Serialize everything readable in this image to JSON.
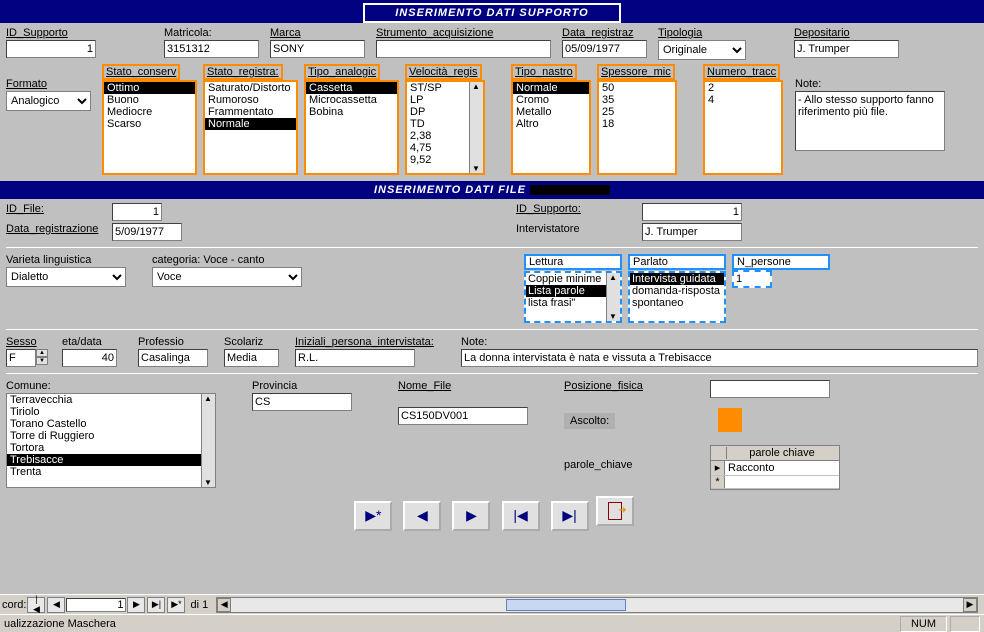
{
  "header1": "INSERIMENTO DATI SUPPORTO",
  "header2": "INSERIMENTO DATI FILE",
  "supporto": {
    "id_label": "ID_Supporto",
    "id_value": "1",
    "matricola_label": "Matricola:",
    "matricola_value": "3151312",
    "marca_label": "Marca",
    "marca_value": "SONY",
    "strumento_label": "Strumento_acquisizione",
    "strumento_value": "",
    "data_label": "Data_registraz",
    "data_value": "05/09/1977",
    "tipologia_label": "Tipologia",
    "tipologia_value": "Originale",
    "depositario_label": "Depositario",
    "depositario_value": "J. Trumper",
    "formato_label": "Formato",
    "formato_value": "Analogico",
    "note_label": "Note:",
    "note_value": "- Allo stesso supporto fanno riferimento più file."
  },
  "boxes": {
    "stato_conserv": {
      "title": "Stato_conserv",
      "items": [
        "Ottimo",
        "Buono",
        "Mediocre",
        "Scarso"
      ],
      "selected": "Ottimo"
    },
    "stato_registra": {
      "title": "Stato_registra:",
      "items": [
        "Saturato/Distorto",
        "Rumoroso",
        "Frammentato",
        "Normale"
      ],
      "selected": "Normale"
    },
    "tipo_analogic": {
      "title": "Tipo_analogic",
      "items": [
        "Cassetta",
        "Microcassetta",
        "Bobina"
      ],
      "selected": "Cassetta"
    },
    "velocita": {
      "title": "Velocità_regis",
      "items": [
        "ST/SP",
        "LP",
        "DP",
        "TD",
        "2,38",
        "4,75",
        "9,52"
      ],
      "selected": ""
    },
    "tipo_nastro": {
      "title": "Tipo_nastro",
      "items": [
        "Normale",
        "Cromo",
        "Metallo",
        "Altro"
      ],
      "selected": "Normale"
    },
    "spessore": {
      "title": "Spessore_mic",
      "items": [
        "50",
        "35",
        "25",
        "18"
      ],
      "selected": ""
    },
    "numero_tracc": {
      "title": "Numero_tracc",
      "items": [
        "2",
        "4"
      ],
      "selected": ""
    }
  },
  "file": {
    "id_file_label": "ID_File:",
    "id_file_value": "1",
    "data_reg_label": "Data_registrazione",
    "data_reg_value": "5/09/1977",
    "id_supporto_label": "ID_Supporto:",
    "id_supporto_value": "1",
    "intervistatore_label": "Intervistatore",
    "intervistatore_value": "J. Trumper",
    "varieta_label": "Varieta linguistica",
    "varieta_value": "Dialetto",
    "categoria_label": "categoria: Voce - canto",
    "categoria_value": "Voce",
    "lettura_label": "Lettura",
    "lettura_items": [
      "Coppie minime",
      "Lista parole",
      "lista frasi\""
    ],
    "lettura_selected": "Lista parole",
    "parlato_label": "Parlato",
    "parlato_items": [
      "Intervista guidata",
      "domanda-risposta",
      "spontaneo"
    ],
    "parlato_selected": "Intervista guidata",
    "npersone_label": "N_persone",
    "npersone_value": "1",
    "sesso_label": "Sesso",
    "sesso_value": "F",
    "eta_label": "eta/data",
    "eta_value": "40",
    "profess_label": "Professio",
    "profess_value": "Casalinga",
    "scolar_label": "Scolariz",
    "scolar_value": "Media",
    "iniziali_label": "Iniziali_persona_intervistata:",
    "iniziali_value": "R.L.",
    "note2_label": "Note:",
    "note2_value": "La donna intervistata è nata e vissuta a Trebisacce",
    "comune_label": "Comune:",
    "comune_items": [
      "Terravecchia",
      "Tiriolo",
      "Torano Castello",
      "Torre di Ruggiero",
      "Tortora",
      "Trebisacce",
      "Trenta"
    ],
    "comune_selected": "Trebisacce",
    "provincia_label": "Provincia",
    "provincia_value": "CS",
    "nomefile_label": "Nome_File",
    "nomefile_value": "CS150DV001",
    "posizione_label": "Posizione_fisica",
    "posizione_value": "",
    "ascolto_label": "Ascolto:",
    "parole_label": "parole_chiave",
    "keyword_header": "parole chiave",
    "keyword_rows": [
      "Racconto",
      ""
    ]
  },
  "recordbar": {
    "label": "cord:",
    "value": "1",
    "of": "di 1"
  },
  "status": {
    "mode": "ualizzazione Maschera",
    "num": "NUM"
  }
}
